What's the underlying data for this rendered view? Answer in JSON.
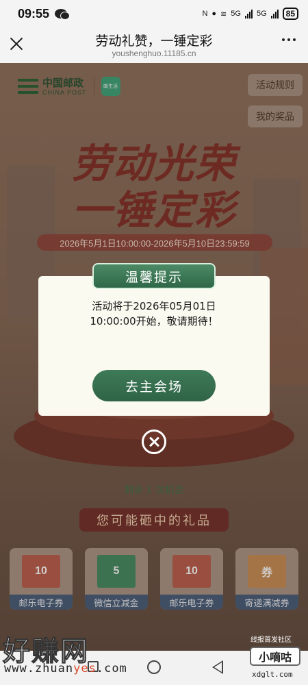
{
  "status_bar": {
    "time": "09:55",
    "network_left": "5G",
    "network_right": "5G",
    "battery": "85"
  },
  "title_bar": {
    "title": "劳动礼赞，一锤定彩",
    "url": "youshenghuo.11185.cn"
  },
  "page": {
    "logo_cn": "中国邮政",
    "logo_en": "CHINA POST",
    "app_icon_text": "邮生活",
    "rules_button": "活动规则",
    "my_prizes_button": "我的奖品",
    "hero_line1": "劳动光荣",
    "hero_line2": "一锤定彩",
    "date_range": "2026年5月1日10:00:00-2026年5月10日23:59:59",
    "chances_text": "剩余 1 次机会",
    "prizes_banner": "您可能砸中的礼品",
    "prize_cards": [
      {
        "label": "邮乐电子券",
        "thumb": "10"
      },
      {
        "label": "微信立减金",
        "thumb": "5"
      },
      {
        "label": "邮乐电子券",
        "thumb": "10"
      },
      {
        "label": "寄递满减券",
        "thumb": "券"
      }
    ]
  },
  "modal": {
    "title": "温馨提示",
    "message_line1": "活动将于2026年05月01日",
    "message_line2": "10:00:00开始，敬请期待！",
    "button": "去主会场"
  },
  "watermark": {
    "brand": "好赚网",
    "url_prefix": "www.zhuan",
    "url_highlight": "yes",
    "url_suffix": ".com",
    "community": "线报首发社区",
    "xdg_name": "小嘀咕",
    "xdg_url": "xdglt.com"
  }
}
